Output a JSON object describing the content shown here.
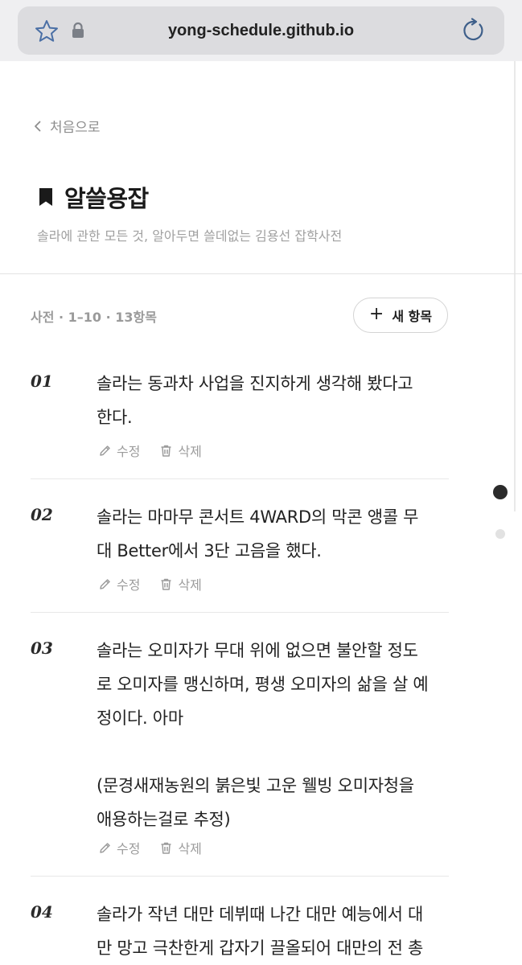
{
  "browser": {
    "url": "yong-schedule.github.io"
  },
  "nav": {
    "back_label": "처음으로"
  },
  "header": {
    "title": "알쓸용잡",
    "subtitle": "솔라에 관한 모든 것, 알아두면 쓸데없는 김용선 잡학사전"
  },
  "list_meta": {
    "summary": "사전 · 1–10 · 13항목",
    "new_button_label": "새 항목"
  },
  "entries": [
    {
      "number": "01",
      "lines": [
        "솔라는 동과차 사업을 진지하게 생각해 봤다고",
        "한다."
      ],
      "edit_label": "수정",
      "delete_label": "삭제"
    },
    {
      "number": "02",
      "lines": [
        "솔라는 마마무 콘서트 4WARD의 막콘 앵콜 무",
        "대 Better에서 3단 고음을 했다."
      ],
      "edit_label": "수정",
      "delete_label": "삭제"
    },
    {
      "number": "03",
      "lines": [
        "솔라는 오미자가 무대 위에 없으면 불안할 정도",
        "로 오미자를 맹신하며, 평생 오미자의 삶을 살 예",
        "정이다. 아마",
        "",
        "(문경새재농원의 붉은빛 고운 웰빙 오미자청을",
        "애용하는걸로 추정)"
      ],
      "edit_label": "수정",
      "delete_label": "삭제"
    },
    {
      "number": "04",
      "lines": [
        "솔라가 작년 대만 데뷔때 나간 대만 예능에서 대",
        "만 망고 극찬한게 갑자기 끌올되어 대만의 전 총"
      ],
      "edit_label": "",
      "delete_label": ""
    }
  ]
}
